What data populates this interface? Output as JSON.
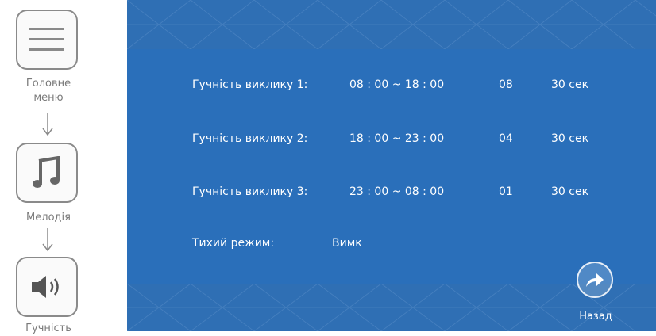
{
  "nav": {
    "items": [
      {
        "label": "Головне\nменю",
        "icon": "menu-icon"
      },
      {
        "label": "Мелодія",
        "icon": "music-note-icon"
      },
      {
        "label": "Гучність",
        "icon": "speaker-icon"
      }
    ]
  },
  "settings": {
    "rows": [
      {
        "label": "Гучність виклику 1:",
        "time": "08 : 00 ~ 18 : 00",
        "level": "08",
        "duration": "30 сек"
      },
      {
        "label": "Гучність виклику 2:",
        "time": "18 : 00 ~ 23 : 00",
        "level": "04",
        "duration": "30 сек"
      },
      {
        "label": "Гучність виклику 3:",
        "time": "23 : 00 ~ 08 : 00",
        "level": "01",
        "duration": "30 сек"
      }
    ],
    "silent_mode": {
      "label": "Тихий режим:",
      "value": "Вимк"
    }
  },
  "back": {
    "label": "Назад",
    "icon": "forward-arrow-icon"
  },
  "colors": {
    "screen": "#2a6ab3",
    "text": "#ffffff",
    "nav_border": "#8a8a8a"
  }
}
